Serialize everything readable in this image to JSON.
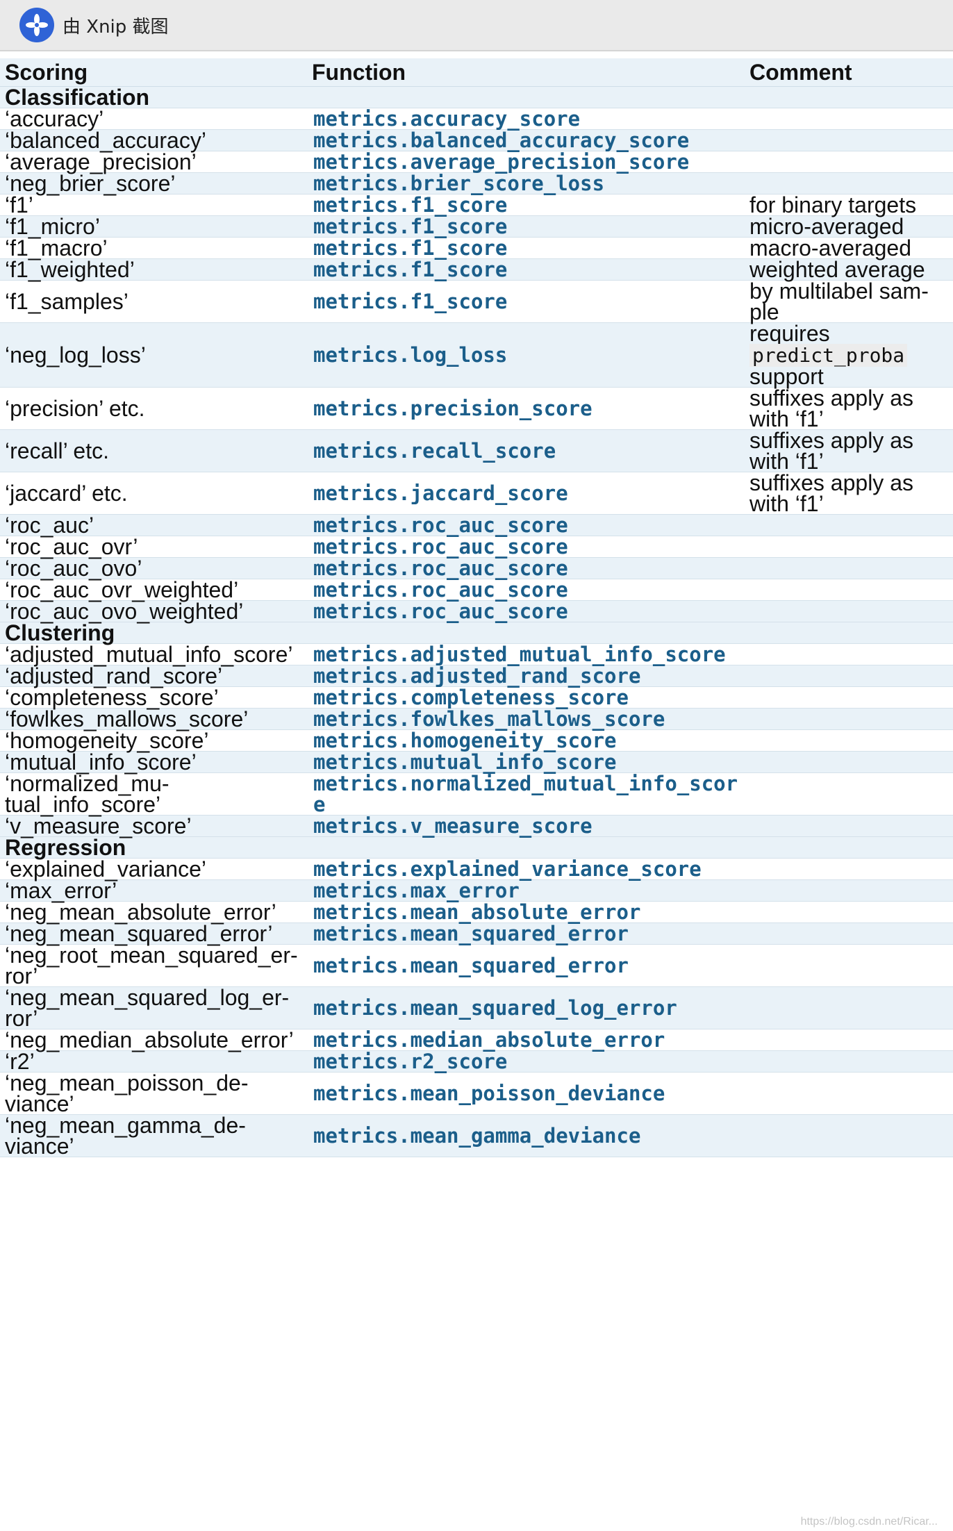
{
  "window": {
    "title": "由 Xnip 截图",
    "icon": "xnip-app-icon"
  },
  "table": {
    "headers": [
      "Scoring",
      "Function",
      "Comment"
    ],
    "sections": [
      {
        "name": "Classification",
        "rows": [
          {
            "scoring": "‘accuracy’",
            "function": "metrics.accuracy_score",
            "comment": ""
          },
          {
            "scoring": "‘balanced_accuracy’",
            "function": "metrics.balanced_accuracy_score",
            "comment": ""
          },
          {
            "scoring": "‘average_precision’",
            "function": "metrics.average_precision_score",
            "comment": ""
          },
          {
            "scoring": "‘neg_brier_score’",
            "function": "metrics.brier_score_loss",
            "comment": ""
          },
          {
            "scoring": "‘f1’",
            "function": "metrics.f1_score",
            "comment": "for binary targets"
          },
          {
            "scoring": "‘f1_micro’",
            "function": "metrics.f1_score",
            "comment": "micro-averaged"
          },
          {
            "scoring": "‘f1_macro’",
            "function": "metrics.f1_score",
            "comment": "macro-averaged"
          },
          {
            "scoring": "‘f1_weighted’",
            "function": "metrics.f1_score",
            "comment": "weighted average"
          },
          {
            "scoring": "‘f1_samples’",
            "function": "metrics.f1_score",
            "comment": "by multilabel sam-ple"
          },
          {
            "scoring": "‘neg_log_loss’",
            "function": "metrics.log_loss",
            "comment": "requires",
            "comment_code": "predict_proba",
            "comment_tail": "support"
          },
          {
            "scoring": "‘precision’ etc.",
            "function": "metrics.precision_score",
            "comment": "suffixes apply as with ‘f1’"
          },
          {
            "scoring": "‘recall’ etc.",
            "function": "metrics.recall_score",
            "comment": "suffixes apply as with ‘f1’"
          },
          {
            "scoring": "‘jaccard’ etc.",
            "function": "metrics.jaccard_score",
            "comment": "suffixes apply as with ‘f1’"
          },
          {
            "scoring": "‘roc_auc’",
            "function": "metrics.roc_auc_score",
            "comment": ""
          },
          {
            "scoring": "‘roc_auc_ovr’",
            "function": "metrics.roc_auc_score",
            "comment": ""
          },
          {
            "scoring": "‘roc_auc_ovo’",
            "function": "metrics.roc_auc_score",
            "comment": ""
          },
          {
            "scoring": "‘roc_auc_ovr_weighted’",
            "function": "metrics.roc_auc_score",
            "comment": ""
          },
          {
            "scoring": "‘roc_auc_ovo_weighted’",
            "function": "metrics.roc_auc_score",
            "comment": ""
          }
        ]
      },
      {
        "name": "Clustering",
        "rows": [
          {
            "scoring": "‘adjusted_mutual_info_score’",
            "function": "metrics.adjusted_mutual_info_score",
            "comment": ""
          },
          {
            "scoring": "‘adjusted_rand_score’",
            "function": "metrics.adjusted_rand_score",
            "comment": ""
          },
          {
            "scoring": "‘completeness_score’",
            "function": "metrics.completeness_score",
            "comment": ""
          },
          {
            "scoring": "‘fowlkes_mallows_score’",
            "function": "metrics.fowlkes_mallows_score",
            "comment": ""
          },
          {
            "scoring": "‘homogeneity_score’",
            "function": "metrics.homogeneity_score",
            "comment": ""
          },
          {
            "scoring": "‘mutual_info_score’",
            "function": "metrics.mutual_info_score",
            "comment": ""
          },
          {
            "scoring": "‘normalized_mu-tual_info_score’",
            "function": "metrics.normalized_mutual_info_score",
            "comment": ""
          },
          {
            "scoring": "‘v_measure_score’",
            "function": "metrics.v_measure_score",
            "comment": ""
          }
        ]
      },
      {
        "name": "Regression",
        "rows": [
          {
            "scoring": "‘explained_variance’",
            "function": "metrics.explained_variance_score",
            "comment": ""
          },
          {
            "scoring": "‘max_error’",
            "function": "metrics.max_error",
            "comment": ""
          },
          {
            "scoring": "‘neg_mean_absolute_error’",
            "function": "metrics.mean_absolute_error",
            "comment": ""
          },
          {
            "scoring": "‘neg_mean_squared_error’",
            "function": "metrics.mean_squared_error",
            "comment": ""
          },
          {
            "scoring": "‘neg_root_mean_squared_er-ror’",
            "function": "metrics.mean_squared_error",
            "comment": ""
          },
          {
            "scoring": "‘neg_mean_squared_log_er-ror’",
            "function": "metrics.mean_squared_log_error",
            "comment": ""
          },
          {
            "scoring": "‘neg_median_absolute_error’",
            "function": "metrics.median_absolute_error",
            "comment": ""
          },
          {
            "scoring": "‘r2’",
            "function": "metrics.r2_score",
            "comment": ""
          },
          {
            "scoring": "‘neg_mean_poisson_de-viance’",
            "function": "metrics.mean_poisson_deviance",
            "comment": ""
          },
          {
            "scoring": "‘neg_mean_gamma_de-viance’",
            "function": "metrics.mean_gamma_deviance",
            "comment": ""
          }
        ]
      }
    ]
  },
  "watermark": "https://blog.csdn.net/Ricar..."
}
